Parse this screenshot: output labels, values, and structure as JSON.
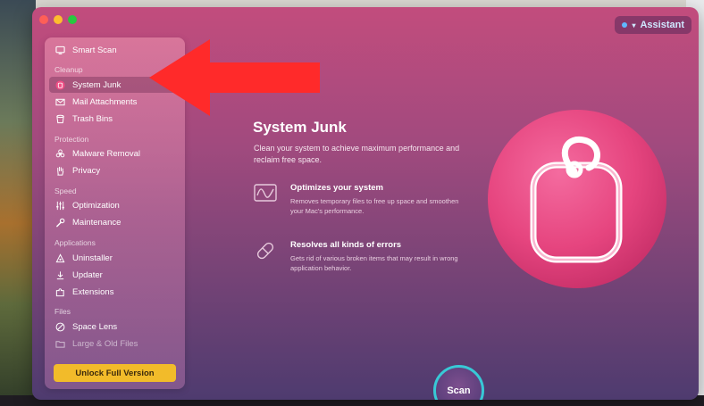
{
  "window": {
    "traffic_lights": [
      "close",
      "minimize",
      "zoom"
    ]
  },
  "assistant": {
    "label": "Assistant"
  },
  "sidebar": {
    "top_item": {
      "label": "Smart Scan",
      "icon": "monitor-icon"
    },
    "sections": [
      {
        "title": "Cleanup",
        "items": [
          {
            "label": "System Junk",
            "icon": "junk-icon",
            "active": true
          },
          {
            "label": "Mail Attachments",
            "icon": "mail-icon"
          },
          {
            "label": "Trash Bins",
            "icon": "trash-icon"
          }
        ]
      },
      {
        "title": "Protection",
        "items": [
          {
            "label": "Malware Removal",
            "icon": "biohazard-icon"
          },
          {
            "label": "Privacy",
            "icon": "hand-icon"
          }
        ]
      },
      {
        "title": "Speed",
        "items": [
          {
            "label": "Optimization",
            "icon": "sliders-icon"
          },
          {
            "label": "Maintenance",
            "icon": "wrench-icon"
          }
        ]
      },
      {
        "title": "Applications",
        "items": [
          {
            "label": "Uninstaller",
            "icon": "uninstaller-icon"
          },
          {
            "label": "Updater",
            "icon": "updater-icon"
          },
          {
            "label": "Extensions",
            "icon": "extensions-icon"
          }
        ]
      },
      {
        "title": "Files",
        "items": [
          {
            "label": "Space Lens",
            "icon": "lens-icon"
          },
          {
            "label": "Large & Old Files",
            "icon": "folder-icon",
            "dim": true
          }
        ]
      }
    ],
    "unlock_button": "Unlock Full Version"
  },
  "main": {
    "title": "System Junk",
    "description": "Clean your system to achieve maximum performance and reclaim free space.",
    "features": [
      {
        "title": "Optimizes your system",
        "description": "Removes temporary files to free up space and smoothen your Mac's performance.",
        "icon": "performance-graph-icon"
      },
      {
        "title": "Resolves all kinds of errors",
        "description": "Gets rid of various broken items that may result in wrong application behavior.",
        "icon": "pill-icon"
      }
    ],
    "hero_icon": "system-junk-hero-icon"
  },
  "scan_button": "Scan",
  "colors": {
    "accent_arrow": "#ff2a2a",
    "unlock": "#f2bb2a",
    "scan_ring": "#38c9d6",
    "hero_pink": "#ee4f8e"
  }
}
